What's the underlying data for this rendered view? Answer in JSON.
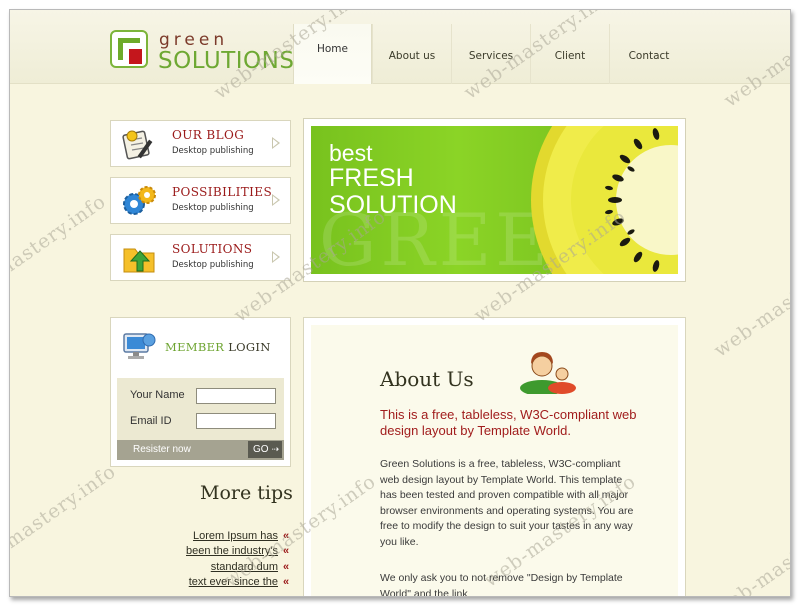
{
  "brand": {
    "line1": "green",
    "line2": "SOLUTIONS"
  },
  "nav": [
    "Home",
    "About us",
    "Services",
    "Client",
    "Contact"
  ],
  "side_boxes": [
    {
      "title": "OUR BLOG",
      "subtitle": "Desktop publishing",
      "icon": "notepad-icon"
    },
    {
      "title": "POSSIBILITIES",
      "subtitle": "Desktop publishing",
      "icon": "gears-icon"
    },
    {
      "title": "SOLUTIONS",
      "subtitle": "Desktop publishing",
      "icon": "folder-arrow-icon"
    }
  ],
  "banner": {
    "line1": "best",
    "line2": "FRESH",
    "line3": "SOLUTION",
    "ghost": "GREEN"
  },
  "login": {
    "title_part1": "MEMBER",
    "title_part2": " LOGIN",
    "name_label": "Your Name",
    "email_label": "Email ID",
    "register": "Resister now",
    "go": "GO"
  },
  "tips": {
    "title": "More tips",
    "items": [
      "Lorem Ipsum has",
      "been the industry's",
      "standard dum",
      "text ever since the"
    ],
    "marker": "«"
  },
  "about": {
    "title": "About Us",
    "lead": "This is a free, tableless, W3C-compliant web design layout by Template World.",
    "p1": "Green Solutions is a free, tableless, W3C-compliant web design layout by Template World. This template has been tested and proven compatible with all major browser environments and operating systems. You are free to modify the design to suit your tastes in any way you like.",
    "p2": "We only ask you to not remove \"Design by Template World\" and the link"
  },
  "watermark": "web-mastery.info",
  "colors": {
    "background": "#f8f5df",
    "accent_green": "#6ea833",
    "accent_red": "#9a1919"
  }
}
